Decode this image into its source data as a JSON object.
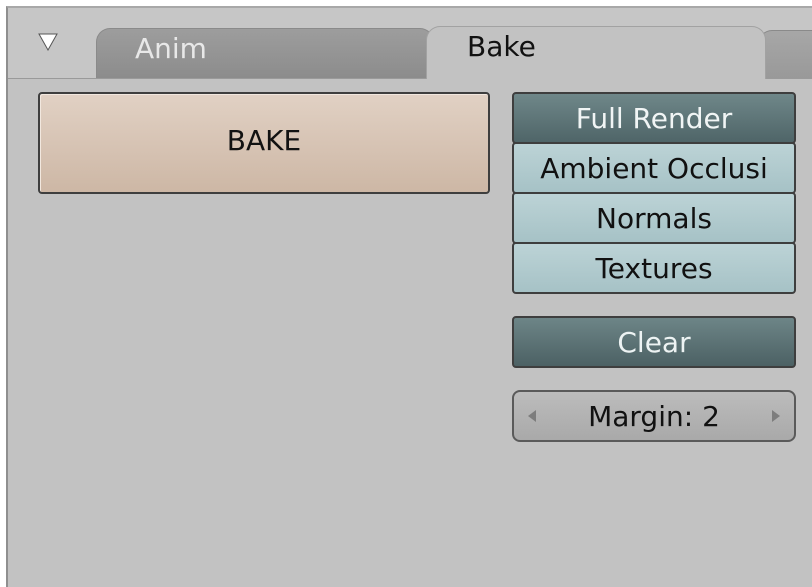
{
  "header": {
    "collapse_icon": "triangle-down-icon",
    "tabs": [
      {
        "label": "Anim",
        "active": false
      },
      {
        "label": "Bake",
        "active": true
      }
    ]
  },
  "bake_panel": {
    "bake_button_label": "BAKE",
    "bake_modes": [
      {
        "label": "Full Render",
        "selected": true
      },
      {
        "label": "Ambient Occlusi",
        "selected": false
      },
      {
        "label": "Normals",
        "selected": false
      },
      {
        "label": "Textures",
        "selected": false
      }
    ],
    "clear_label": "Clear",
    "clear_active": true,
    "margin_field": {
      "text": "Margin: 2",
      "value": 2
    },
    "icons": {
      "left": "arrow-left-icon",
      "right": "arrow-right-icon"
    }
  },
  "colors": {
    "panel_bg": "#c2c2c2",
    "bake_button": "#d8c6b7",
    "mode_active": "#5f7779",
    "mode_inactive": "#b0c8cb",
    "field_bg": "#b3b3b3"
  }
}
